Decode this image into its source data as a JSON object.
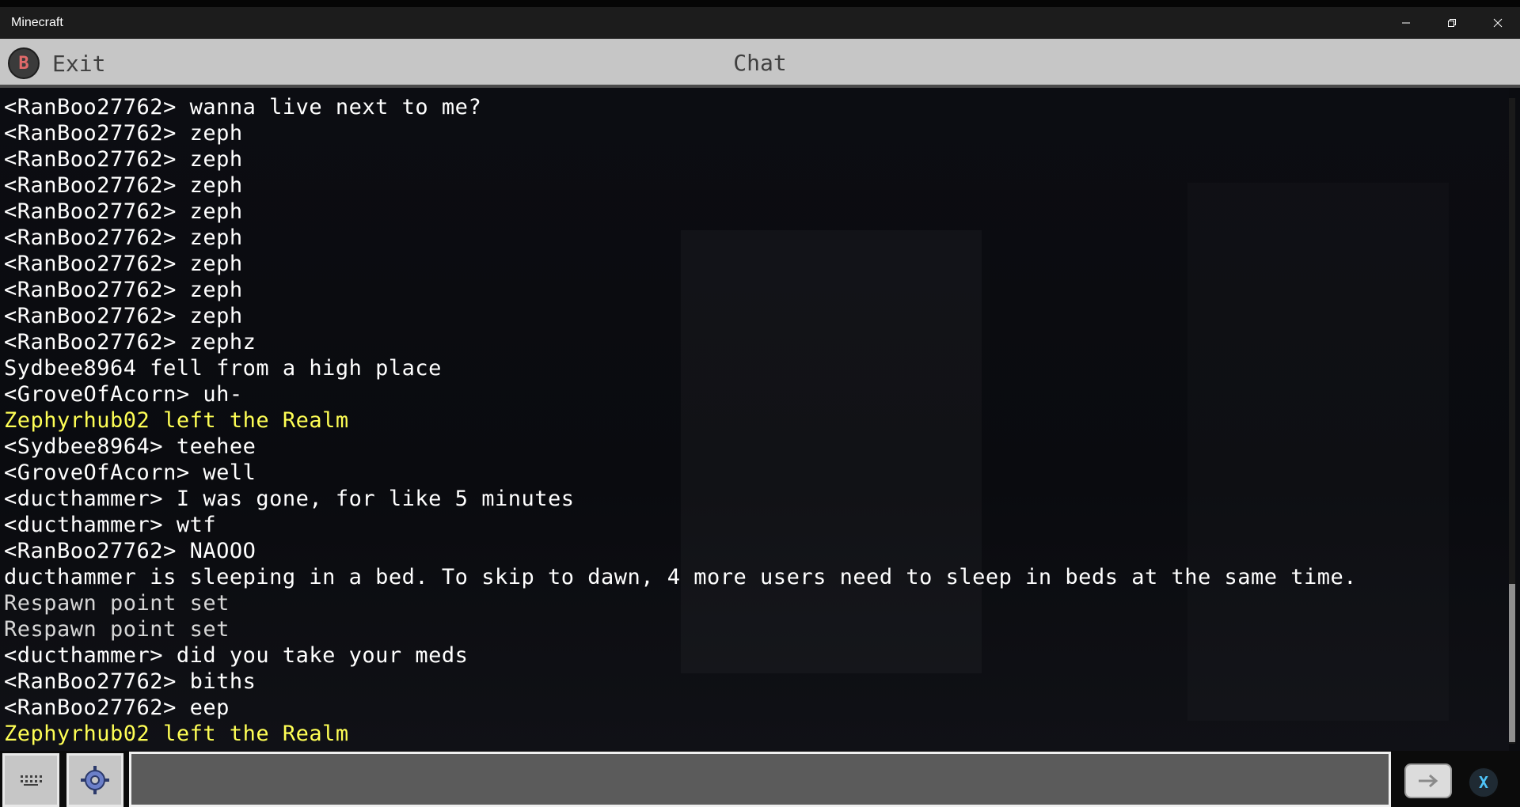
{
  "window": {
    "title": "Minecraft"
  },
  "header": {
    "exit_key": "B",
    "exit_label": "Exit",
    "title": "Chat"
  },
  "chat": {
    "messages": [
      {
        "text": "<RanBoo27762> wanna live next to me?",
        "color": "#ffffff"
      },
      {
        "text": "<RanBoo27762> zeph",
        "color": "#ffffff"
      },
      {
        "text": "<RanBoo27762> zeph",
        "color": "#ffffff"
      },
      {
        "text": "<RanBoo27762> zeph",
        "color": "#ffffff"
      },
      {
        "text": "<RanBoo27762> zeph",
        "color": "#ffffff"
      },
      {
        "text": "<RanBoo27762> zeph",
        "color": "#ffffff"
      },
      {
        "text": "<RanBoo27762> zeph",
        "color": "#ffffff"
      },
      {
        "text": "<RanBoo27762> zeph",
        "color": "#ffffff"
      },
      {
        "text": "<RanBoo27762> zeph",
        "color": "#ffffff"
      },
      {
        "text": "<RanBoo27762> zephz",
        "color": "#ffffff"
      },
      {
        "text": "Sydbee8964 fell from a high place",
        "color": "#ffffff"
      },
      {
        "text": "<GroveOfAcorn> uh-",
        "color": "#ffffff"
      },
      {
        "text": "Zephyrhub02 left the Realm",
        "color": "#ffff55"
      },
      {
        "text": "<Sydbee8964> teehee",
        "color": "#ffffff"
      },
      {
        "text": "<GroveOfAcorn> well",
        "color": "#ffffff"
      },
      {
        "text": "<ducthammer> I was gone, for like 5 minutes",
        "color": "#ffffff"
      },
      {
        "text": "<ducthammer> wtf",
        "color": "#ffffff"
      },
      {
        "text": "<RanBoo27762> NAOOO",
        "color": "#ffffff"
      },
      {
        "text": "ducthammer is sleeping in a bed. To skip to dawn, 4 more users need to sleep in beds at the same time.",
        "color": "#ffffff"
      },
      {
        "text": "Respawn point set",
        "color": "#d6d6d6"
      },
      {
        "text": "Respawn point set",
        "color": "#d6d6d6"
      },
      {
        "text": "<ducthammer> did you take your meds",
        "color": "#ffffff"
      },
      {
        "text": "<RanBoo27762> biths",
        "color": "#ffffff"
      },
      {
        "text": "<RanBoo27762> eep",
        "color": "#ffffff"
      },
      {
        "text": "Zephyrhub02 left the Realm",
        "color": "#ffff55"
      }
    ]
  },
  "input": {
    "value": "",
    "placeholder": ""
  },
  "bottom": {
    "keyboard_icon": "keyboard-icon",
    "settings_icon": "gear-icon",
    "send_icon": "send-arrow-icon",
    "x_key": "X"
  }
}
